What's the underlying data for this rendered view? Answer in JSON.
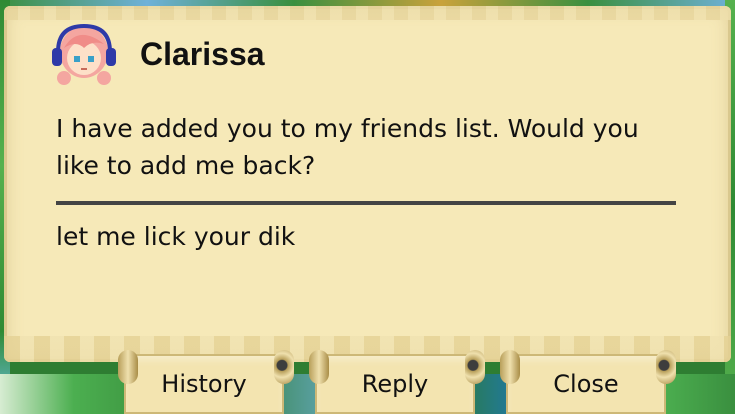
{
  "dialog": {
    "sender": "Clarissa",
    "message": "I have added you to my friends list. Would you like to add me back?",
    "reply": "let me lick your dik"
  },
  "buttons": {
    "history": "History",
    "reply": "Reply",
    "close": "Close"
  },
  "colors": {
    "parchment": "#f6e9b8",
    "text": "#111111",
    "hair": "#f4a6a0",
    "headphones": "#2e3aa8"
  }
}
